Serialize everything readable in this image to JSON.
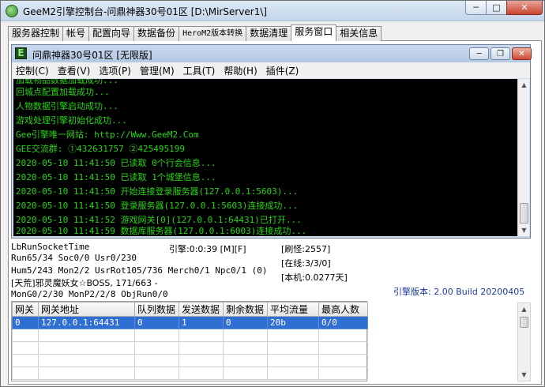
{
  "window": {
    "title": "GeeM2引擎控制台-问鼎神器30号01区 [D:\\MirServer1\\]",
    "min_glyph": "─",
    "max_glyph": "□",
    "close_glyph": "✕"
  },
  "tabs": [
    {
      "label": "服务器控制"
    },
    {
      "label": "帐号"
    },
    {
      "label": "配置向导"
    },
    {
      "label": "数据备份"
    },
    {
      "label": "HeroM2版本转换"
    },
    {
      "label": "数据清理"
    },
    {
      "label": "服务窗口"
    },
    {
      "label": "相关信息"
    }
  ],
  "inner_window": {
    "icon_letter": "E",
    "title": "问鼎神器30号01区 [无限版]",
    "min_glyph": "─",
    "max_glyph": "❐",
    "close_glyph": "✕"
  },
  "menu": [
    {
      "label": "控制(C)"
    },
    {
      "label": "查看(V)"
    },
    {
      "label": "选项(P)"
    },
    {
      "label": "管理(M)"
    },
    {
      "label": "工具(T)"
    },
    {
      "label": "帮助(H)"
    },
    {
      "label": "插件(Z)"
    }
  ],
  "console": {
    "cut_line": "加载物品数据加载成功...",
    "lines": [
      "回城点配置加载成功...",
      "人物数据引擎启动成功...",
      "游戏处理引擎初始化成功...",
      "Gee引擎唯一网站: http://Www.GeeM2.Com",
      "GEE交流群: ①432631757   ②425495199",
      "2020-05-10 11:41:50 已读取 0个行会信息...",
      "2020-05-10 11:41:50 已读取 1个城堡信息...",
      "2020-05-10 11:41:50 开始连接登录服务器(127.0.0.1:5603)...",
      "2020-05-10 11:41:50 登录服务器(127.0.0.1:5603)连接成功...",
      "2020-05-10 11:41:52 游戏网关[0](127.0.0.1:64431)已打开...",
      "2020-05-10 11:41:59 数据库服务器(127.0.0.1:6003)连接成功..."
    ]
  },
  "status": {
    "run_socket_time": "LbRunSocketTime",
    "run_line": "Run65/34 Soc0/0 Usr0/230",
    "hum_line": "Hum5/243 Mon2/2 UsrRot105/736 Merch0/1 Npc0/1 (0)",
    "boss_line": "[天荒]邪灵魔妖女☆BOSS, 171/663 -",
    "mon_line": "MonG0/2/30 MonP2/2/8 ObjRun0/0",
    "engine_time": "引擎:0:0:39 [M][F]",
    "refresh_monster": "[刷怪:2557]",
    "online": "[在线:3/3/0]",
    "local": "[本机:0.0277天]",
    "engine_version": "引擎版本: 2.00 Build 20200405"
  },
  "gateway_grid": {
    "columns": [
      "网关",
      "网关地址",
      "队列数据",
      "发送数据",
      "剩余数据",
      "平均流量",
      "最高人数"
    ],
    "rows": [
      [
        "0",
        "127.0.0.1:64431",
        "0",
        "1",
        "0",
        "20b",
        "0/0"
      ]
    ]
  },
  "scroll": {
    "up_glyph": "▲",
    "down_glyph": "▼"
  }
}
